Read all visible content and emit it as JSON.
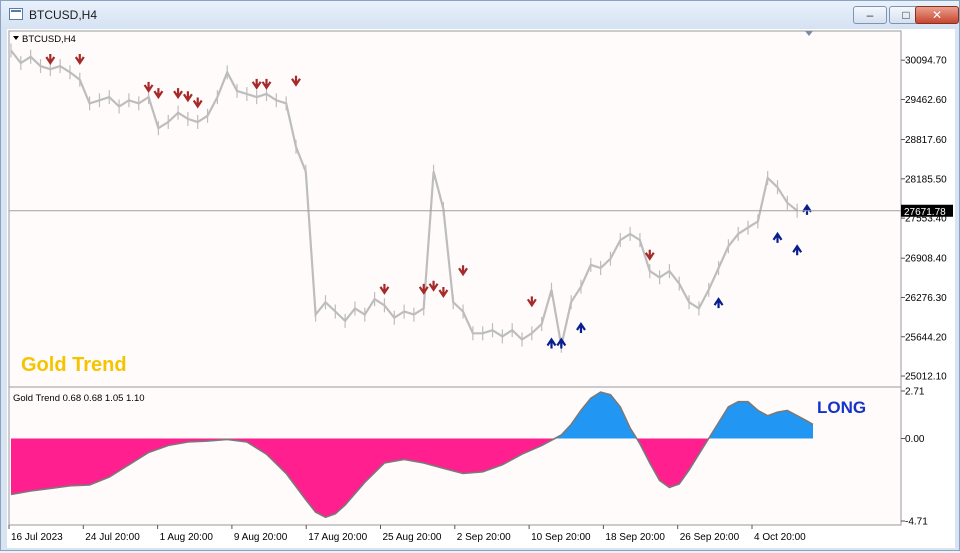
{
  "window": {
    "title": "BTCUSD,H4",
    "buttons": {
      "minimize": "–",
      "maximize": "□",
      "close": "✕"
    }
  },
  "main_panel": {
    "symbol_label": "BTCUSD,H4",
    "watermark": "Gold Trend",
    "current_price_label": "27671.78"
  },
  "indicator_panel": {
    "label": "Gold Trend  0.68 0.68 1.05 1.10",
    "signal": "LONG"
  },
  "colors": {
    "price_line": "#bdbdbd",
    "sell_arrow": "#a52a2a",
    "buy_arrow": "#0a1f8f",
    "positive_fill": "#2196f3",
    "negative_fill": "#ff1f8e",
    "watermark": "#f5c400",
    "signal_text": "#1633c9"
  },
  "chart_data": [
    {
      "type": "line",
      "title": "BTCUSD,H4",
      "y_ticks": [
        "30094.70",
        "29462.60",
        "28817.60",
        "28185.50",
        "27553.40",
        "26908.40",
        "26276.30",
        "25644.20",
        "25012.10"
      ],
      "x_ticks": [
        "16 Jul 2023",
        "24 Jul 20:00",
        "1 Aug 20:00",
        "9 Aug 20:00",
        "17 Aug 20:00",
        "25 Aug 20:00",
        "2 Sep 20:00",
        "10 Sep 20:00",
        "18 Sep 20:00",
        "26 Sep 20:00",
        "4 Oct 20:00"
      ],
      "ylim": [
        24900,
        30500
      ],
      "xlim": [
        0,
        81
      ],
      "current_price": 27671.78,
      "series": [
        {
          "x": [
            0,
            1,
            2,
            3,
            4,
            5,
            6,
            7,
            8,
            9,
            10,
            11,
            12,
            13,
            14,
            15,
            16,
            17,
            18,
            19,
            20,
            21,
            22,
            23,
            24,
            25,
            26,
            27,
            28,
            29,
            30,
            31,
            32,
            33,
            34,
            35,
            36,
            37,
            38,
            39,
            40,
            41,
            42,
            43,
            44,
            45,
            46,
            47,
            48,
            49,
            50,
            51,
            52,
            53,
            54,
            55,
            56,
            57,
            58,
            59,
            60,
            61,
            62,
            63,
            64,
            65,
            66,
            67,
            68,
            69,
            70,
            71,
            72,
            73,
            74,
            75,
            76,
            77,
            78,
            79,
            80
          ],
          "y": [
            30250,
            30050,
            30150,
            30000,
            29950,
            30000,
            29900,
            29780,
            29400,
            29450,
            29500,
            29350,
            29450,
            29400,
            29500,
            29000,
            29100,
            29250,
            29150,
            29100,
            29200,
            29500,
            29900,
            29600,
            29550,
            29500,
            29550,
            29450,
            29400,
            28700,
            28300,
            26000,
            26200,
            26050,
            25900,
            26100,
            26000,
            26250,
            26150,
            25950,
            26050,
            26000,
            26100,
            28300,
            27700,
            26200,
            26050,
            25700,
            25700,
            25750,
            25650,
            25750,
            25600,
            25700,
            25850,
            26400,
            25500,
            26200,
            26450,
            26800,
            26750,
            26900,
            27200,
            27300,
            27200,
            26700,
            26600,
            26700,
            26500,
            26200,
            26100,
            26400,
            26750,
            27100,
            27300,
            27400,
            27500,
            28200,
            28050,
            27800,
            27672
          ]
        }
      ],
      "sell_arrows": [
        [
          4,
          30050
        ],
        [
          7,
          30050
        ],
        [
          14,
          29600
        ],
        [
          15,
          29500
        ],
        [
          17,
          29500
        ],
        [
          18,
          29450
        ],
        [
          19,
          29350
        ],
        [
          25,
          29650
        ],
        [
          26,
          29650
        ],
        [
          29,
          29700
        ],
        [
          38,
          26350
        ],
        [
          42,
          26350
        ],
        [
          43,
          26400
        ],
        [
          44,
          26300
        ],
        [
          46,
          26650
        ],
        [
          53,
          26150
        ],
        [
          65,
          26900
        ]
      ],
      "buy_arrows": [
        [
          55,
          25600
        ],
        [
          56,
          25600
        ],
        [
          58,
          25850
        ],
        [
          72,
          26250
        ],
        [
          78,
          27300
        ],
        [
          80,
          27100
        ],
        [
          81,
          27750
        ]
      ]
    },
    {
      "type": "area",
      "title": "Gold Trend",
      "y_ticks": [
        "2.71",
        "0.00",
        "-4.71"
      ],
      "ylim": [
        -4.71,
        2.71
      ],
      "xlim": [
        0,
        81
      ],
      "series": [
        {
          "name": "Gold Trend",
          "x": [
            0,
            2,
            4,
            6,
            8,
            10,
            12,
            14,
            16,
            18,
            20,
            22,
            24,
            26,
            28,
            30,
            31,
            32,
            33,
            34,
            36,
            38,
            40,
            42,
            44,
            46,
            48,
            50,
            52,
            54,
            56,
            57,
            58,
            59,
            60,
            61,
            62,
            63,
            64,
            65,
            66,
            67,
            68,
            69,
            70,
            71,
            72,
            73,
            74,
            75,
            76,
            77,
            78,
            79,
            80,
            81,
            82
          ],
          "y": [
            -3.2,
            -3.0,
            -2.85,
            -2.7,
            -2.65,
            -2.2,
            -1.5,
            -0.8,
            -0.4,
            -0.2,
            -0.15,
            -0.05,
            -0.2,
            -0.9,
            -2.0,
            -3.5,
            -4.2,
            -4.5,
            -4.3,
            -3.8,
            -2.5,
            -1.4,
            -1.2,
            -1.4,
            -1.7,
            -2.0,
            -1.9,
            -1.5,
            -0.9,
            -0.4,
            0.2,
            0.8,
            1.6,
            2.3,
            2.65,
            2.5,
            1.8,
            0.6,
            -0.3,
            -1.4,
            -2.4,
            -2.8,
            -2.6,
            -1.8,
            -0.9,
            0.0,
            0.9,
            1.8,
            2.1,
            2.1,
            1.6,
            1.3,
            1.5,
            1.6,
            1.3,
            1.0,
            0.8
          ]
        }
      ]
    }
  ]
}
